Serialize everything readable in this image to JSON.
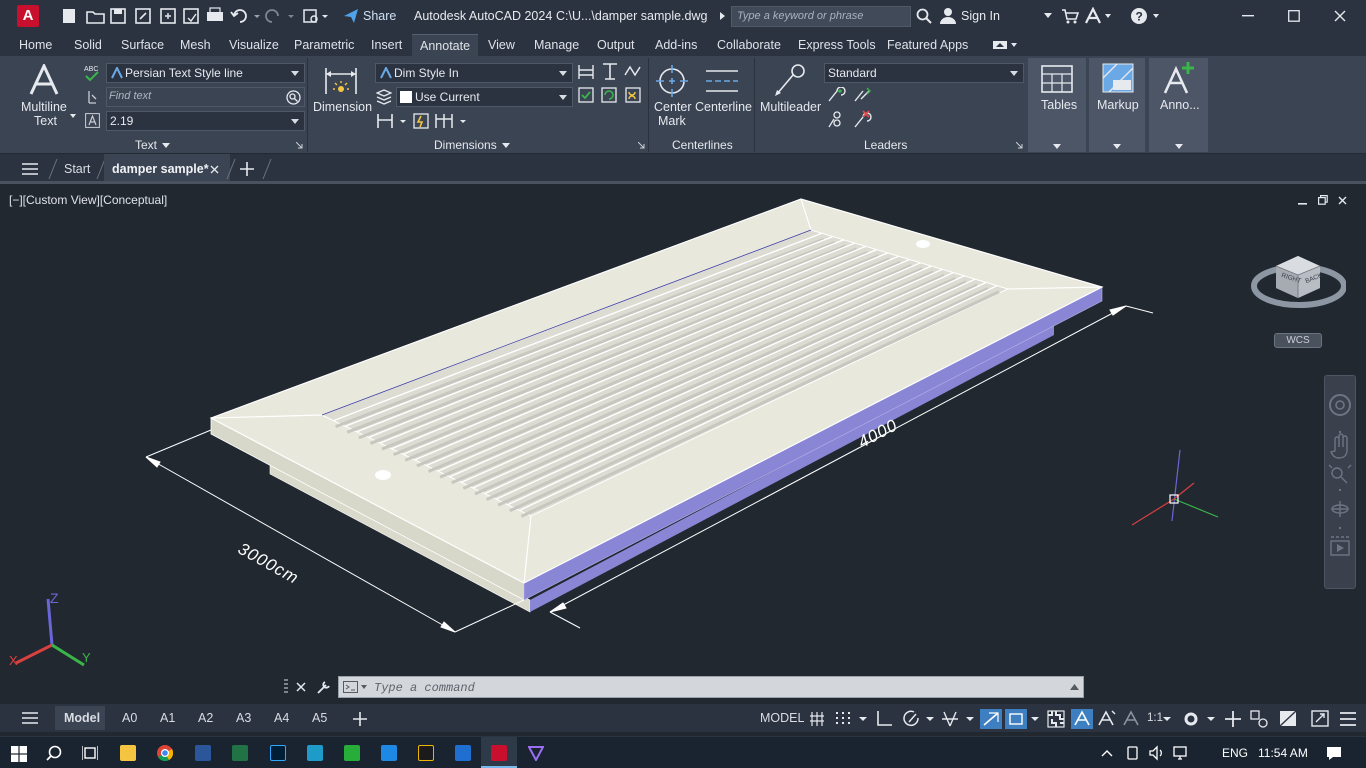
{
  "app": {
    "title": "Autodesk AutoCAD 2024",
    "file_path": "C:\\U...\\damper sample.dwg",
    "share_label": "Share",
    "search_placeholder": "Type a keyword or phrase",
    "sign_in_label": "Sign In",
    "logo_letter": "A"
  },
  "menu_tabs": [
    "Home",
    "Solid",
    "Surface",
    "Mesh",
    "Visualize",
    "Parametric",
    "Insert",
    "Annotate",
    "View",
    "Manage",
    "Output",
    "Add-ins",
    "Collaborate",
    "Express Tools",
    "Featured Apps"
  ],
  "active_tab": "Annotate",
  "ribbon": {
    "text_panel": {
      "title": "Text",
      "multiline_label_1": "Multiline",
      "multiline_label_2": "Text",
      "text_style": "Persian Text Style line",
      "find_placeholder": "Find text",
      "text_height": "2.19"
    },
    "dimensions_panel": {
      "title": "Dimensions",
      "dimension_label": "Dimension",
      "dim_style": "Dim Style In",
      "layer": "Use Current"
    },
    "centerlines_panel": {
      "title": "Centerlines",
      "center_mark_label_1": "Center",
      "center_mark_label_2": "Mark",
      "centerline_label": "Centerline"
    },
    "leaders_panel": {
      "title": "Leaders",
      "multileader_label": "Multileader",
      "leader_style": "Standard"
    },
    "tables_label": "Tables",
    "markup_label": "Markup",
    "anno_label": "Anno..."
  },
  "file_tabs": {
    "start": "Start",
    "active": "damper sample*"
  },
  "viewport": {
    "label": "[−][Custom View][Conceptual]",
    "dim_length": "4000",
    "dim_width": "3000cm",
    "wcs_label": "WCS",
    "viewcube_right": "RIGHT",
    "viewcube_back": "BACK",
    "axis_x": "X",
    "axis_y": "Y",
    "axis_z": "Z"
  },
  "command": {
    "placeholder": "Type a command"
  },
  "status": {
    "layout_tabs": [
      "Model",
      "A0",
      "A1",
      "A2",
      "A3",
      "A4",
      "A5"
    ],
    "active_layout": "Model",
    "model_label": "MODEL",
    "scale": "1:1"
  },
  "taskbar": {
    "language": "ENG",
    "time": "11:54 AM"
  },
  "colors": {
    "accent": "#c8102e",
    "ribbon_bg": "#3b4453",
    "viewport_bg": "#212830",
    "model_face": "#e8e8dc",
    "model_edge_blue": "#8a86d6"
  }
}
